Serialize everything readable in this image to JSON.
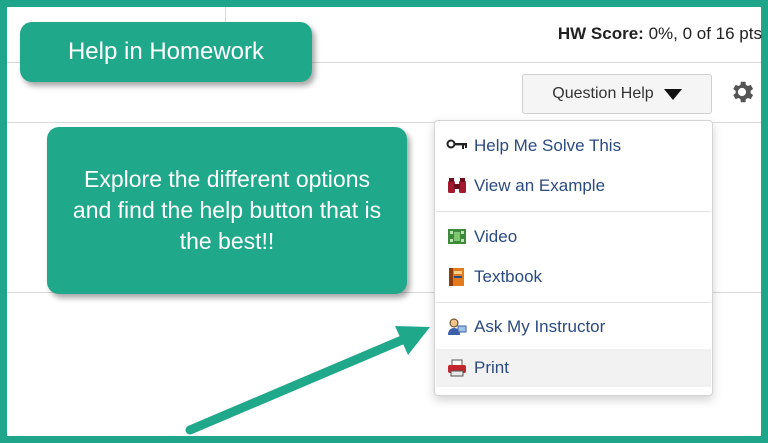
{
  "header": {
    "hw_score_label": "HW Score:",
    "hw_score_value": " 0%, 0 of 16 pts"
  },
  "toolbar": {
    "question_help_label": "Question Help",
    "settings_icon": "gear-icon"
  },
  "callouts": {
    "top_label": "Help in Homework",
    "main_text": "Explore the different options and find the help button that is the best!!"
  },
  "help_menu": {
    "items": [
      {
        "label": "Help Me Solve This",
        "icon": "key-icon"
      },
      {
        "label": "View an Example",
        "icon": "binoculars-icon"
      },
      {
        "label": "Video",
        "icon": "film-icon"
      },
      {
        "label": "Textbook",
        "icon": "book-icon"
      },
      {
        "label": "Ask My Instructor",
        "icon": "instructor-icon"
      },
      {
        "label": "Print",
        "icon": "printer-icon"
      }
    ]
  },
  "colors": {
    "accent_teal": "#1fa58a",
    "menu_link": "#2a4a80"
  }
}
